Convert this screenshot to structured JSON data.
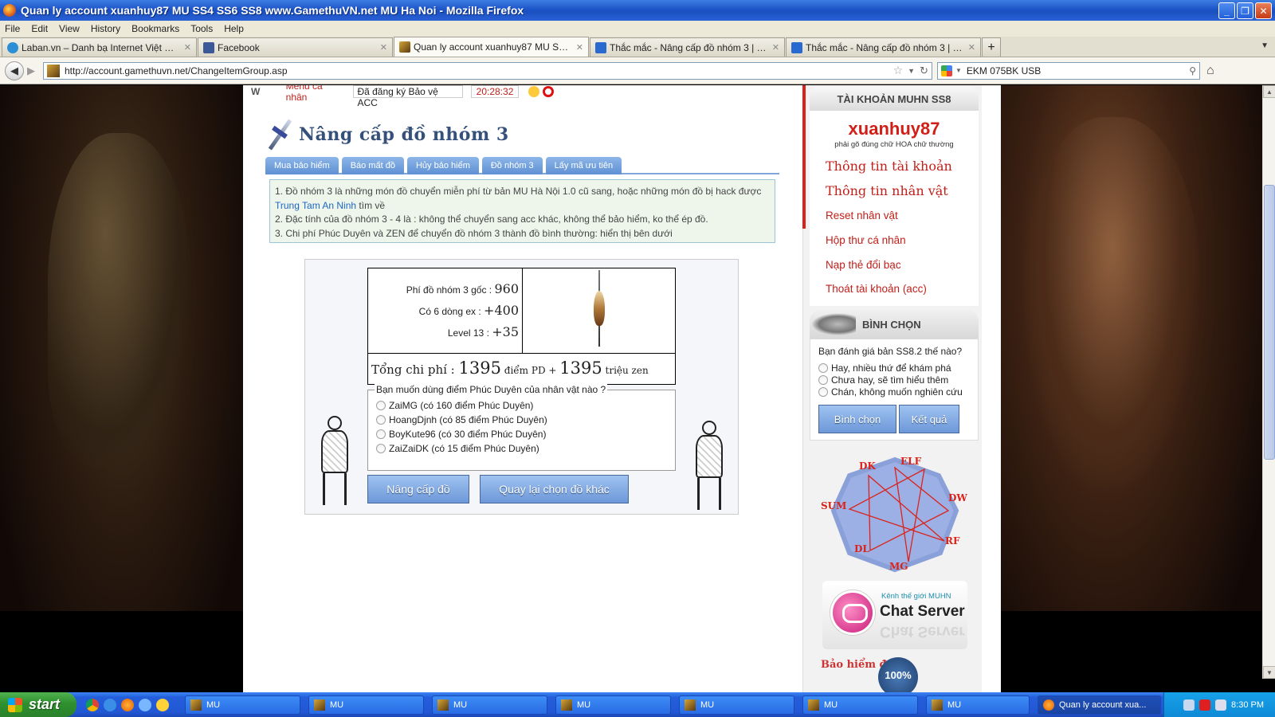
{
  "window": {
    "title": "Quan ly account xuanhuy87 MU SS4 SS6 SS8 www.GamethuVN.net MU Ha Noi - Mozilla Firefox",
    "minimize": "_",
    "maximize": "❐",
    "close": "✕"
  },
  "menubar": [
    "File",
    "Edit",
    "View",
    "History",
    "Bookmarks",
    "Tools",
    "Help"
  ],
  "tabs": [
    {
      "label": "Laban.vn – Danh bạ Internet Việt Nam",
      "icon": "laban-icon",
      "color": "#2c8fd6"
    },
    {
      "label": "Facebook",
      "icon": "facebook-icon",
      "color": "#3b5998"
    },
    {
      "label": "Quan ly account xuanhuy87 MU SS4 SS6 ...",
      "icon": "mu-icon",
      "color": "#8a5a1a"
    },
    {
      "label": "Thắc mắc - Nâng cấp đồ nhóm 3 | Game t...",
      "icon": "gamethu-icon",
      "color": "#2a6ad0"
    },
    {
      "label": "Thắc mắc - Nâng cấp đồ nhóm 3 | Game t...",
      "icon": "gamethu-icon",
      "color": "#2a6ad0"
    }
  ],
  "new_tab": "+",
  "nav": {
    "url": "http://account.gamethuvn.net/ChangeItemGroup.asp",
    "search_value": "EKM 075BK USB"
  },
  "topstrip": {
    "menu": "Menu cá nhân",
    "protect": "Đã đăng ký Bảo vệ ACC",
    "clock": "20:28:32"
  },
  "page": {
    "heading": "Nâng cấp đồ nhóm 3",
    "subtabs": [
      "Mua bảo hiểm",
      "Báo mất đồ",
      "Hủy bảo hiểm",
      "Đồ nhóm 3",
      "Lấy mã ưu tiên"
    ],
    "info": {
      "line1": "1. Đồ nhóm 3 là những món đồ chuyển miễn phí từ bản MU Hà Nội 1.0 cũ sang, hoặc những món đồ bị hack được",
      "link": "Trung Tam An Ninh",
      "line1_tail": " tìm về",
      "line2": "2. Đặc tính của đồ nhóm 3 - 4 là : không thể chuyển sang acc khác, không thể bảo hiểm, ko thể ép đồ.",
      "line3": "3. Chi phí Phúc Duyên và ZEN để chuyển đồ nhóm 3 thành đồ bình thường: hiển thị bên dưới"
    },
    "cost": {
      "base_label": "Phí đồ nhóm 3 gốc : ",
      "base_value": "960",
      "ex_label": "Có 6 dòng ex : ",
      "ex_value": "+400",
      "level_label": "Level 13 : ",
      "level_value": "+35",
      "total_label": "Tổng chi phí : ",
      "total_pd": "1395",
      "pd_unit": " điểm PD + ",
      "total_zen": "1395",
      "zen_unit": " triệu zen"
    },
    "char_legend": "Bạn muốn dùng điểm Phúc Duyên của nhân vật nào ?",
    "characters": [
      "ZaiMG (có 160 điểm Phúc Duyên)",
      "HoangDjnh (có 85 điểm Phúc Duyên)",
      "BoyKute96 (có 30 điểm Phúc Duyên)",
      "ZaiZaiDK (có 15 điểm Phúc Duyên)"
    ],
    "upgrade_button": "Nâng cấp đồ",
    "back_button": "Quay lại chọn đồ khác"
  },
  "sidebar": {
    "header": "TÀI KHOẢN MUHN SS8",
    "username": "xuanhuy87",
    "case_hint": "phải gõ đúng chữ HOA chữ thường",
    "links": [
      "Thông tin tài khoản",
      "Thông tin nhân vật",
      "Reset nhân vật",
      "Hộp thư cá nhân",
      "Nạp thẻ đổi bạc",
      "Thoát tài khoản (acc)"
    ],
    "vote_header": "BÌNH CHỌN",
    "vote_question": "Bạn đánh giá bản SS8.2 thế nào?",
    "vote_options": [
      "Hay, nhiều thứ để khám phá",
      "Chưa hay, sẽ tìm hiểu thêm",
      "Chán, không muốn nghiên cứu"
    ],
    "vote_button": "Bình chọn",
    "result_button": "Kết quả",
    "classes": [
      "DK",
      "ELF",
      "DW",
      "RF",
      "MG",
      "DL",
      "SUM"
    ],
    "chat_small": "Kênh thế giới MUHN",
    "chat_big": "Chat Server",
    "insurance": "Bảo hiểm đồ",
    "badge": "100%"
  },
  "taskbar": {
    "start": "start",
    "tasks": [
      "MU",
      "MU",
      "MU",
      "MU",
      "MU",
      "MU",
      "MU"
    ],
    "active_task": "Quan ly account xua...",
    "clock": "8:30 PM"
  }
}
